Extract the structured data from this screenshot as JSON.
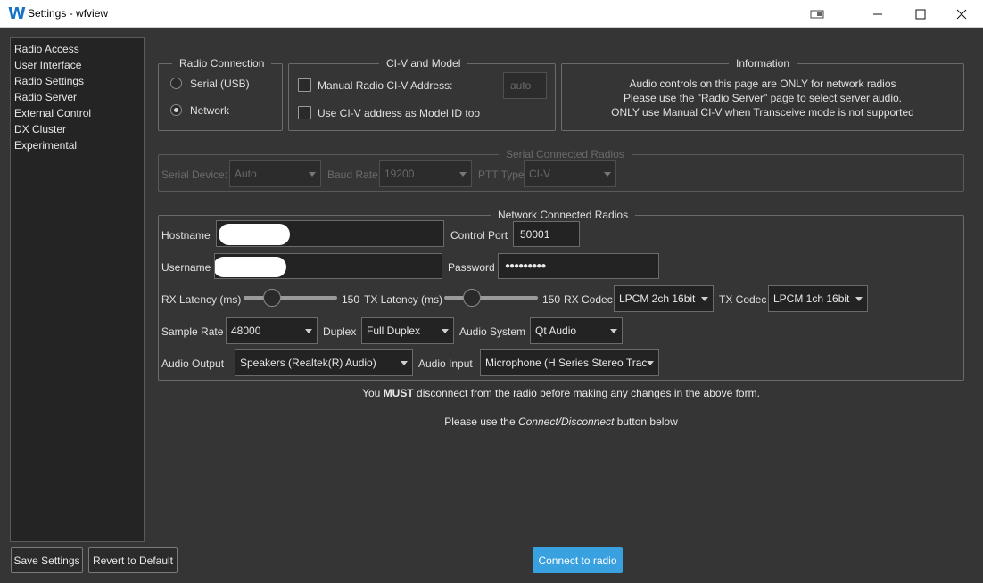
{
  "window": {
    "title": "Settings - wfview",
    "icon_letter": "W"
  },
  "sidebar": {
    "items": [
      {
        "label": "Radio Access"
      },
      {
        "label": "User Interface"
      },
      {
        "label": "Radio Settings"
      },
      {
        "label": "Radio Server"
      },
      {
        "label": "External Control"
      },
      {
        "label": "DX Cluster"
      },
      {
        "label": "Experimental"
      }
    ]
  },
  "radio_connection": {
    "title": "Radio Connection",
    "serial_label": "Serial (USB)",
    "network_label": "Network",
    "selected": "Network"
  },
  "civ": {
    "title": "CI-V and Model",
    "manual_label": "Manual Radio CI-V Address:",
    "address_placeholder": "auto",
    "model_id_label": "Use CI-V address as Model ID too"
  },
  "information": {
    "title": "Information",
    "line1": "Audio controls on this page are ONLY for network radios",
    "line2": "Please use the \"Radio Server\" page to select server audio.",
    "line3": "ONLY use Manual CI-V when Transceive mode is not supported"
  },
  "serial": {
    "title": "Serial Connected Radios",
    "device_label": "Serial Device:",
    "device_value": "Auto",
    "baud_label": "Baud Rate",
    "baud_value": "19200",
    "ptt_label": "PTT Type",
    "ptt_value": "CI-V"
  },
  "network": {
    "title": "Network Connected Radios",
    "hostname_label": "Hostname",
    "control_port_label": "Control Port",
    "control_port_value": "50001",
    "username_label": "Username",
    "password_label": "Password",
    "password_value": "●●●●●●●●●",
    "rx_latency_label": "RX Latency (ms)",
    "rx_latency_value": "150",
    "tx_latency_label": "TX Latency (ms)",
    "tx_latency_value": "150",
    "rx_codec_label": "RX Codec",
    "rx_codec_value": "LPCM 2ch 16bit",
    "tx_codec_label": "TX Codec",
    "tx_codec_value": "LPCM 1ch 16bit",
    "sample_rate_label": "Sample Rate",
    "sample_rate_value": "48000",
    "duplex_label": "Duplex",
    "duplex_value": "Full Duplex",
    "audio_system_label": "Audio System",
    "audio_system_value": "Qt Audio",
    "audio_output_label": "Audio Output",
    "audio_output_value": "Speakers (Realtek(R) Audio)",
    "audio_input_label": "Audio Input",
    "audio_input_value": "Microphone (H Series Stereo Trac"
  },
  "notes": {
    "disconnect_prefix": "You ",
    "disconnect_bold": "MUST",
    "disconnect_suffix": " disconnect from the radio before making any changes in the above form.",
    "connect_prefix": "Please use the ",
    "connect_italic": "Connect/Disconnect",
    "connect_suffix": " button below"
  },
  "buttons": {
    "save": "Save Settings",
    "revert": "Revert to Default",
    "connect": "Connect to radio"
  },
  "colors": {
    "accent": "#3aa1e0",
    "background": "#353535"
  }
}
